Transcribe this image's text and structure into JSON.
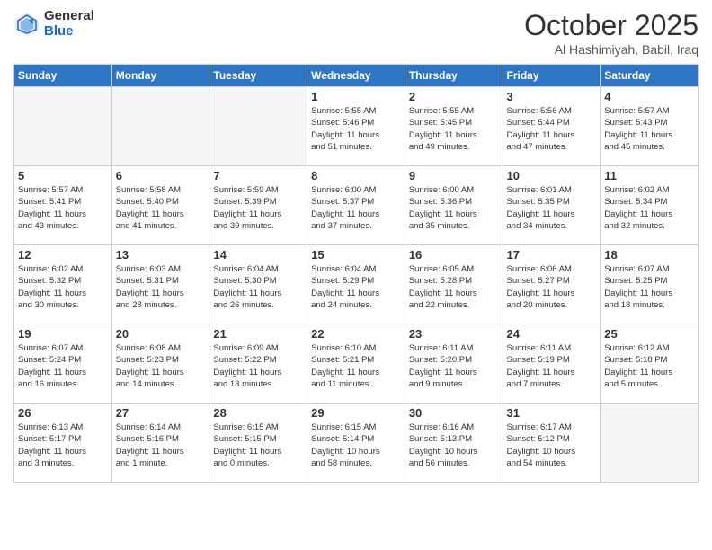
{
  "header": {
    "logo": {
      "general": "General",
      "blue": "Blue"
    },
    "title": "October 2025",
    "location": "Al Hashimiyah, Babil, Iraq"
  },
  "days_of_week": [
    "Sunday",
    "Monday",
    "Tuesday",
    "Wednesday",
    "Thursday",
    "Friday",
    "Saturday"
  ],
  "weeks": [
    [
      {
        "day": "",
        "info": ""
      },
      {
        "day": "",
        "info": ""
      },
      {
        "day": "",
        "info": ""
      },
      {
        "day": "1",
        "info": "Sunrise: 5:55 AM\nSunset: 5:46 PM\nDaylight: 11 hours\nand 51 minutes."
      },
      {
        "day": "2",
        "info": "Sunrise: 5:55 AM\nSunset: 5:45 PM\nDaylight: 11 hours\nand 49 minutes."
      },
      {
        "day": "3",
        "info": "Sunrise: 5:56 AM\nSunset: 5:44 PM\nDaylight: 11 hours\nand 47 minutes."
      },
      {
        "day": "4",
        "info": "Sunrise: 5:57 AM\nSunset: 5:43 PM\nDaylight: 11 hours\nand 45 minutes."
      }
    ],
    [
      {
        "day": "5",
        "info": "Sunrise: 5:57 AM\nSunset: 5:41 PM\nDaylight: 11 hours\nand 43 minutes."
      },
      {
        "day": "6",
        "info": "Sunrise: 5:58 AM\nSunset: 5:40 PM\nDaylight: 11 hours\nand 41 minutes."
      },
      {
        "day": "7",
        "info": "Sunrise: 5:59 AM\nSunset: 5:39 PM\nDaylight: 11 hours\nand 39 minutes."
      },
      {
        "day": "8",
        "info": "Sunrise: 6:00 AM\nSunset: 5:37 PM\nDaylight: 11 hours\nand 37 minutes."
      },
      {
        "day": "9",
        "info": "Sunrise: 6:00 AM\nSunset: 5:36 PM\nDaylight: 11 hours\nand 35 minutes."
      },
      {
        "day": "10",
        "info": "Sunrise: 6:01 AM\nSunset: 5:35 PM\nDaylight: 11 hours\nand 34 minutes."
      },
      {
        "day": "11",
        "info": "Sunrise: 6:02 AM\nSunset: 5:34 PM\nDaylight: 11 hours\nand 32 minutes."
      }
    ],
    [
      {
        "day": "12",
        "info": "Sunrise: 6:02 AM\nSunset: 5:32 PM\nDaylight: 11 hours\nand 30 minutes."
      },
      {
        "day": "13",
        "info": "Sunrise: 6:03 AM\nSunset: 5:31 PM\nDaylight: 11 hours\nand 28 minutes."
      },
      {
        "day": "14",
        "info": "Sunrise: 6:04 AM\nSunset: 5:30 PM\nDaylight: 11 hours\nand 26 minutes."
      },
      {
        "day": "15",
        "info": "Sunrise: 6:04 AM\nSunset: 5:29 PM\nDaylight: 11 hours\nand 24 minutes."
      },
      {
        "day": "16",
        "info": "Sunrise: 6:05 AM\nSunset: 5:28 PM\nDaylight: 11 hours\nand 22 minutes."
      },
      {
        "day": "17",
        "info": "Sunrise: 6:06 AM\nSunset: 5:27 PM\nDaylight: 11 hours\nand 20 minutes."
      },
      {
        "day": "18",
        "info": "Sunrise: 6:07 AM\nSunset: 5:25 PM\nDaylight: 11 hours\nand 18 minutes."
      }
    ],
    [
      {
        "day": "19",
        "info": "Sunrise: 6:07 AM\nSunset: 5:24 PM\nDaylight: 11 hours\nand 16 minutes."
      },
      {
        "day": "20",
        "info": "Sunrise: 6:08 AM\nSunset: 5:23 PM\nDaylight: 11 hours\nand 14 minutes."
      },
      {
        "day": "21",
        "info": "Sunrise: 6:09 AM\nSunset: 5:22 PM\nDaylight: 11 hours\nand 13 minutes."
      },
      {
        "day": "22",
        "info": "Sunrise: 6:10 AM\nSunset: 5:21 PM\nDaylight: 11 hours\nand 11 minutes."
      },
      {
        "day": "23",
        "info": "Sunrise: 6:11 AM\nSunset: 5:20 PM\nDaylight: 11 hours\nand 9 minutes."
      },
      {
        "day": "24",
        "info": "Sunrise: 6:11 AM\nSunset: 5:19 PM\nDaylight: 11 hours\nand 7 minutes."
      },
      {
        "day": "25",
        "info": "Sunrise: 6:12 AM\nSunset: 5:18 PM\nDaylight: 11 hours\nand 5 minutes."
      }
    ],
    [
      {
        "day": "26",
        "info": "Sunrise: 6:13 AM\nSunset: 5:17 PM\nDaylight: 11 hours\nand 3 minutes."
      },
      {
        "day": "27",
        "info": "Sunrise: 6:14 AM\nSunset: 5:16 PM\nDaylight: 11 hours\nand 1 minute."
      },
      {
        "day": "28",
        "info": "Sunrise: 6:15 AM\nSunset: 5:15 PM\nDaylight: 11 hours\nand 0 minutes."
      },
      {
        "day": "29",
        "info": "Sunrise: 6:15 AM\nSunset: 5:14 PM\nDaylight: 10 hours\nand 58 minutes."
      },
      {
        "day": "30",
        "info": "Sunrise: 6:16 AM\nSunset: 5:13 PM\nDaylight: 10 hours\nand 56 minutes."
      },
      {
        "day": "31",
        "info": "Sunrise: 6:17 AM\nSunset: 5:12 PM\nDaylight: 10 hours\nand 54 minutes."
      },
      {
        "day": "",
        "info": ""
      }
    ]
  ]
}
